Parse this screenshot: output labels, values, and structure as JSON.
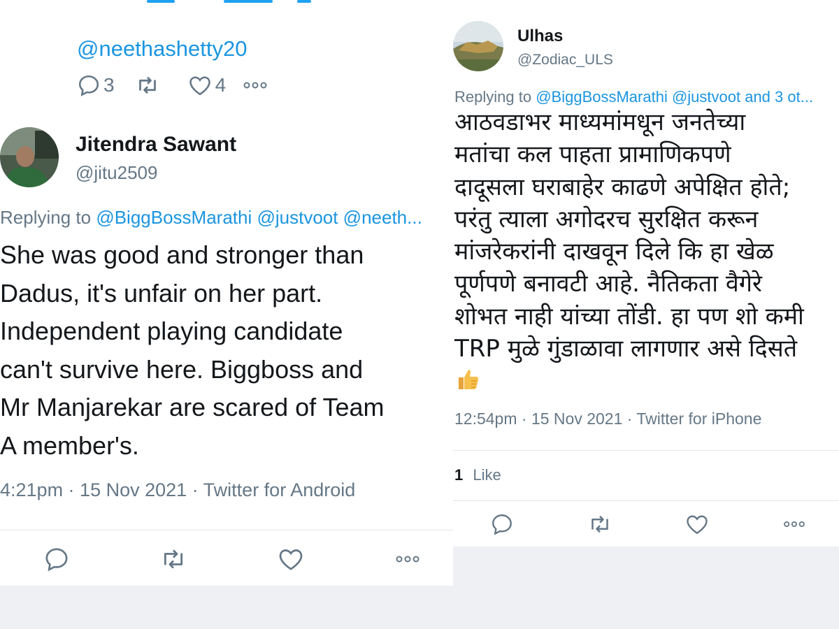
{
  "left_panel": {
    "previous_tweet": {
      "mention": "@neethashetty20",
      "reply_count": "3",
      "like_count": "4"
    },
    "tweet": {
      "author_name": "Jitendra Sawant",
      "author_handle": "@jitu2509",
      "replying_prefix": "Replying to",
      "replying_to": "@BiggBossMarathi @justvoot @neeth...",
      "text": "She was good and stronger than\nDadus, it's unfair on her part.\nIndependent playing candidate\ncan't survive here. Biggboss and\nMr Manjarekar are scared of Team\nA member's.",
      "meta": "4:21pm · 15 Nov 2021 · Twitter for Android"
    }
  },
  "right_panel": {
    "tweet": {
      "author_name": "Ulhas",
      "author_handle": "@Zodiac_ULS",
      "replying_prefix": "Replying to",
      "replying_to": "@BiggBossMarathi @justvoot and 3 ot...",
      "text": "आठवडाभर माध्यमांमधून जनतेच्या\nमतांचा कल पाहता प्रामाणिकपणे\nदादूसला घराबाहेर काढणे अपेक्षित होते;\nपरंतु त्याला अगोदरच सुरक्षित करून\nमांजरेकरांनी दाखवून दिले कि हा खेळ\nपूर्णपणे बनावटी आहे. नैतिकता वैगेरे\nशोभत नाही यांच्या तोंडी. हा पण शो कमी\nTRP मुळे गुंडाळावा लागणार असे दिसते",
      "emoji": "thumbs-up",
      "meta": "12:54pm · 15 Nov 2021 · Twitter for iPhone",
      "likes_number": "1",
      "likes_label": "Like"
    }
  },
  "colors": {
    "link": "#1b95e0",
    "muted": "#657786",
    "text": "#14171a",
    "divider": "#e1e8ed",
    "background_band": "#eef0f3"
  }
}
